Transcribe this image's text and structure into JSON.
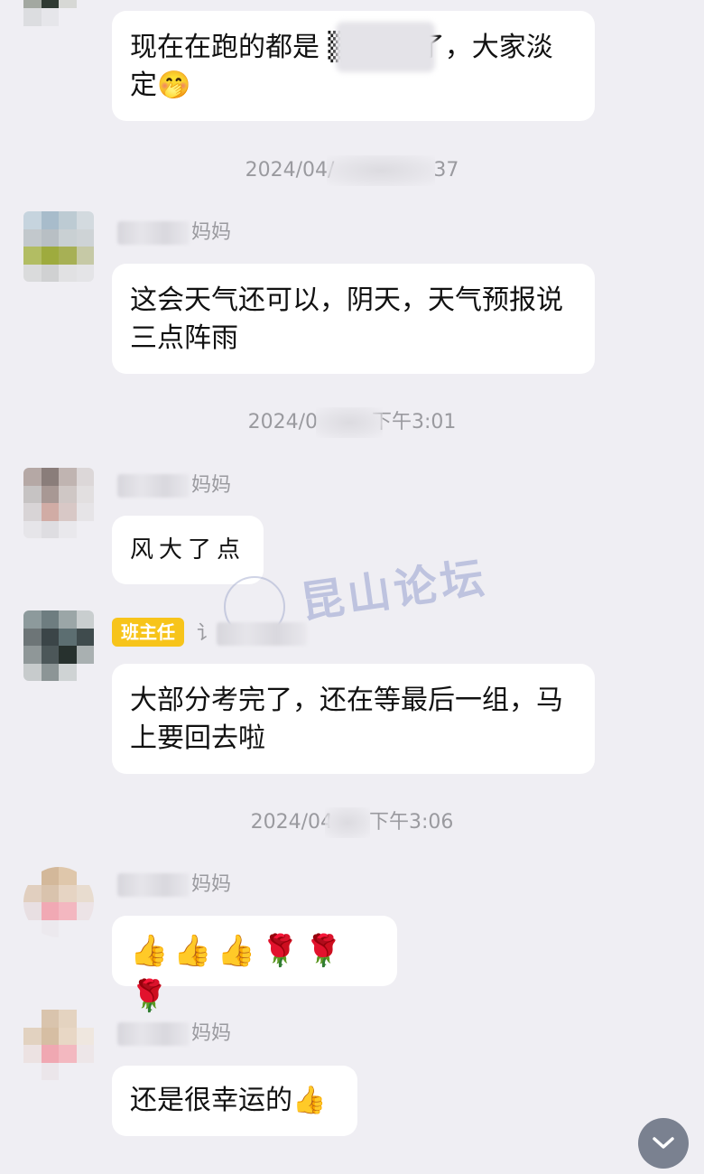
{
  "messages": [
    {
      "text": "现在在跑的都是 ▒▒▒的了，大家淡定🤭"
    },
    {
      "sender_suffix": "妈妈",
      "text": "这会天气还可以，阴天，天气预报说三点阵雨"
    },
    {
      "sender_suffix": "妈妈",
      "text": "风大了点"
    },
    {
      "role_badge": "班主任",
      "sender_suffix": "讠",
      "text": "大部分考完了，还在等最后一组，马上要回去啦"
    },
    {
      "sender_suffix": "妈妈",
      "text": "👍👍👍🌹🌹🌹"
    },
    {
      "sender_suffix": "妈妈",
      "text": "还是很幸运的👍"
    }
  ],
  "timestamps": [
    {
      "left": "2024/04/",
      "right": "37"
    },
    {
      "left": "2024/0",
      "right": "下午3:01"
    },
    {
      "left": "2024/04",
      "right": "下午3:06"
    }
  ],
  "watermark": {
    "text": "昆山论坛"
  },
  "icons": {
    "scroll_down": "chevron-down-icon"
  }
}
